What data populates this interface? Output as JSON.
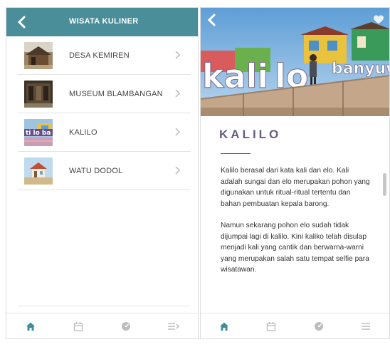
{
  "left": {
    "header": {
      "title": "WISATA KULINER"
    },
    "items": [
      {
        "label": "DESA KEMIREN"
      },
      {
        "label": "MUSEUM BLAMBANGAN"
      },
      {
        "label": "KALILO"
      },
      {
        "label": "WATU DODOL"
      }
    ],
    "tabs": [
      "home-icon",
      "calendar-icon",
      "dashboard-icon",
      "menu-arrow-icon"
    ]
  },
  "right": {
    "hero_sign": "kali lo banyuwangi",
    "heading": "KALILO",
    "paragraphs": [
      "Kalilo berasal dari kata kali dan elo. Kali adalah sungai dan elo merupakan pohon yang digunakan untuk ritual-ritual tertentu dan bahan pembuatan kepala barong.",
      "Namun sekarang pohon elo sudah tidak dijumpai lagi di kalilo. Kini kaliko telah disulap menjadi kali yang cantik dan berwarna-warni yang merupakan salah satu tempat selfie para wisatawan."
    ],
    "tabs": [
      "home-icon",
      "calendar-icon",
      "dashboard-icon",
      "menu-icon"
    ]
  },
  "colors": {
    "header": "#4a8e9a",
    "accent": "#6c5a82",
    "tab_active": "#3f8d98",
    "tab_inactive": "#bdbdbd"
  }
}
